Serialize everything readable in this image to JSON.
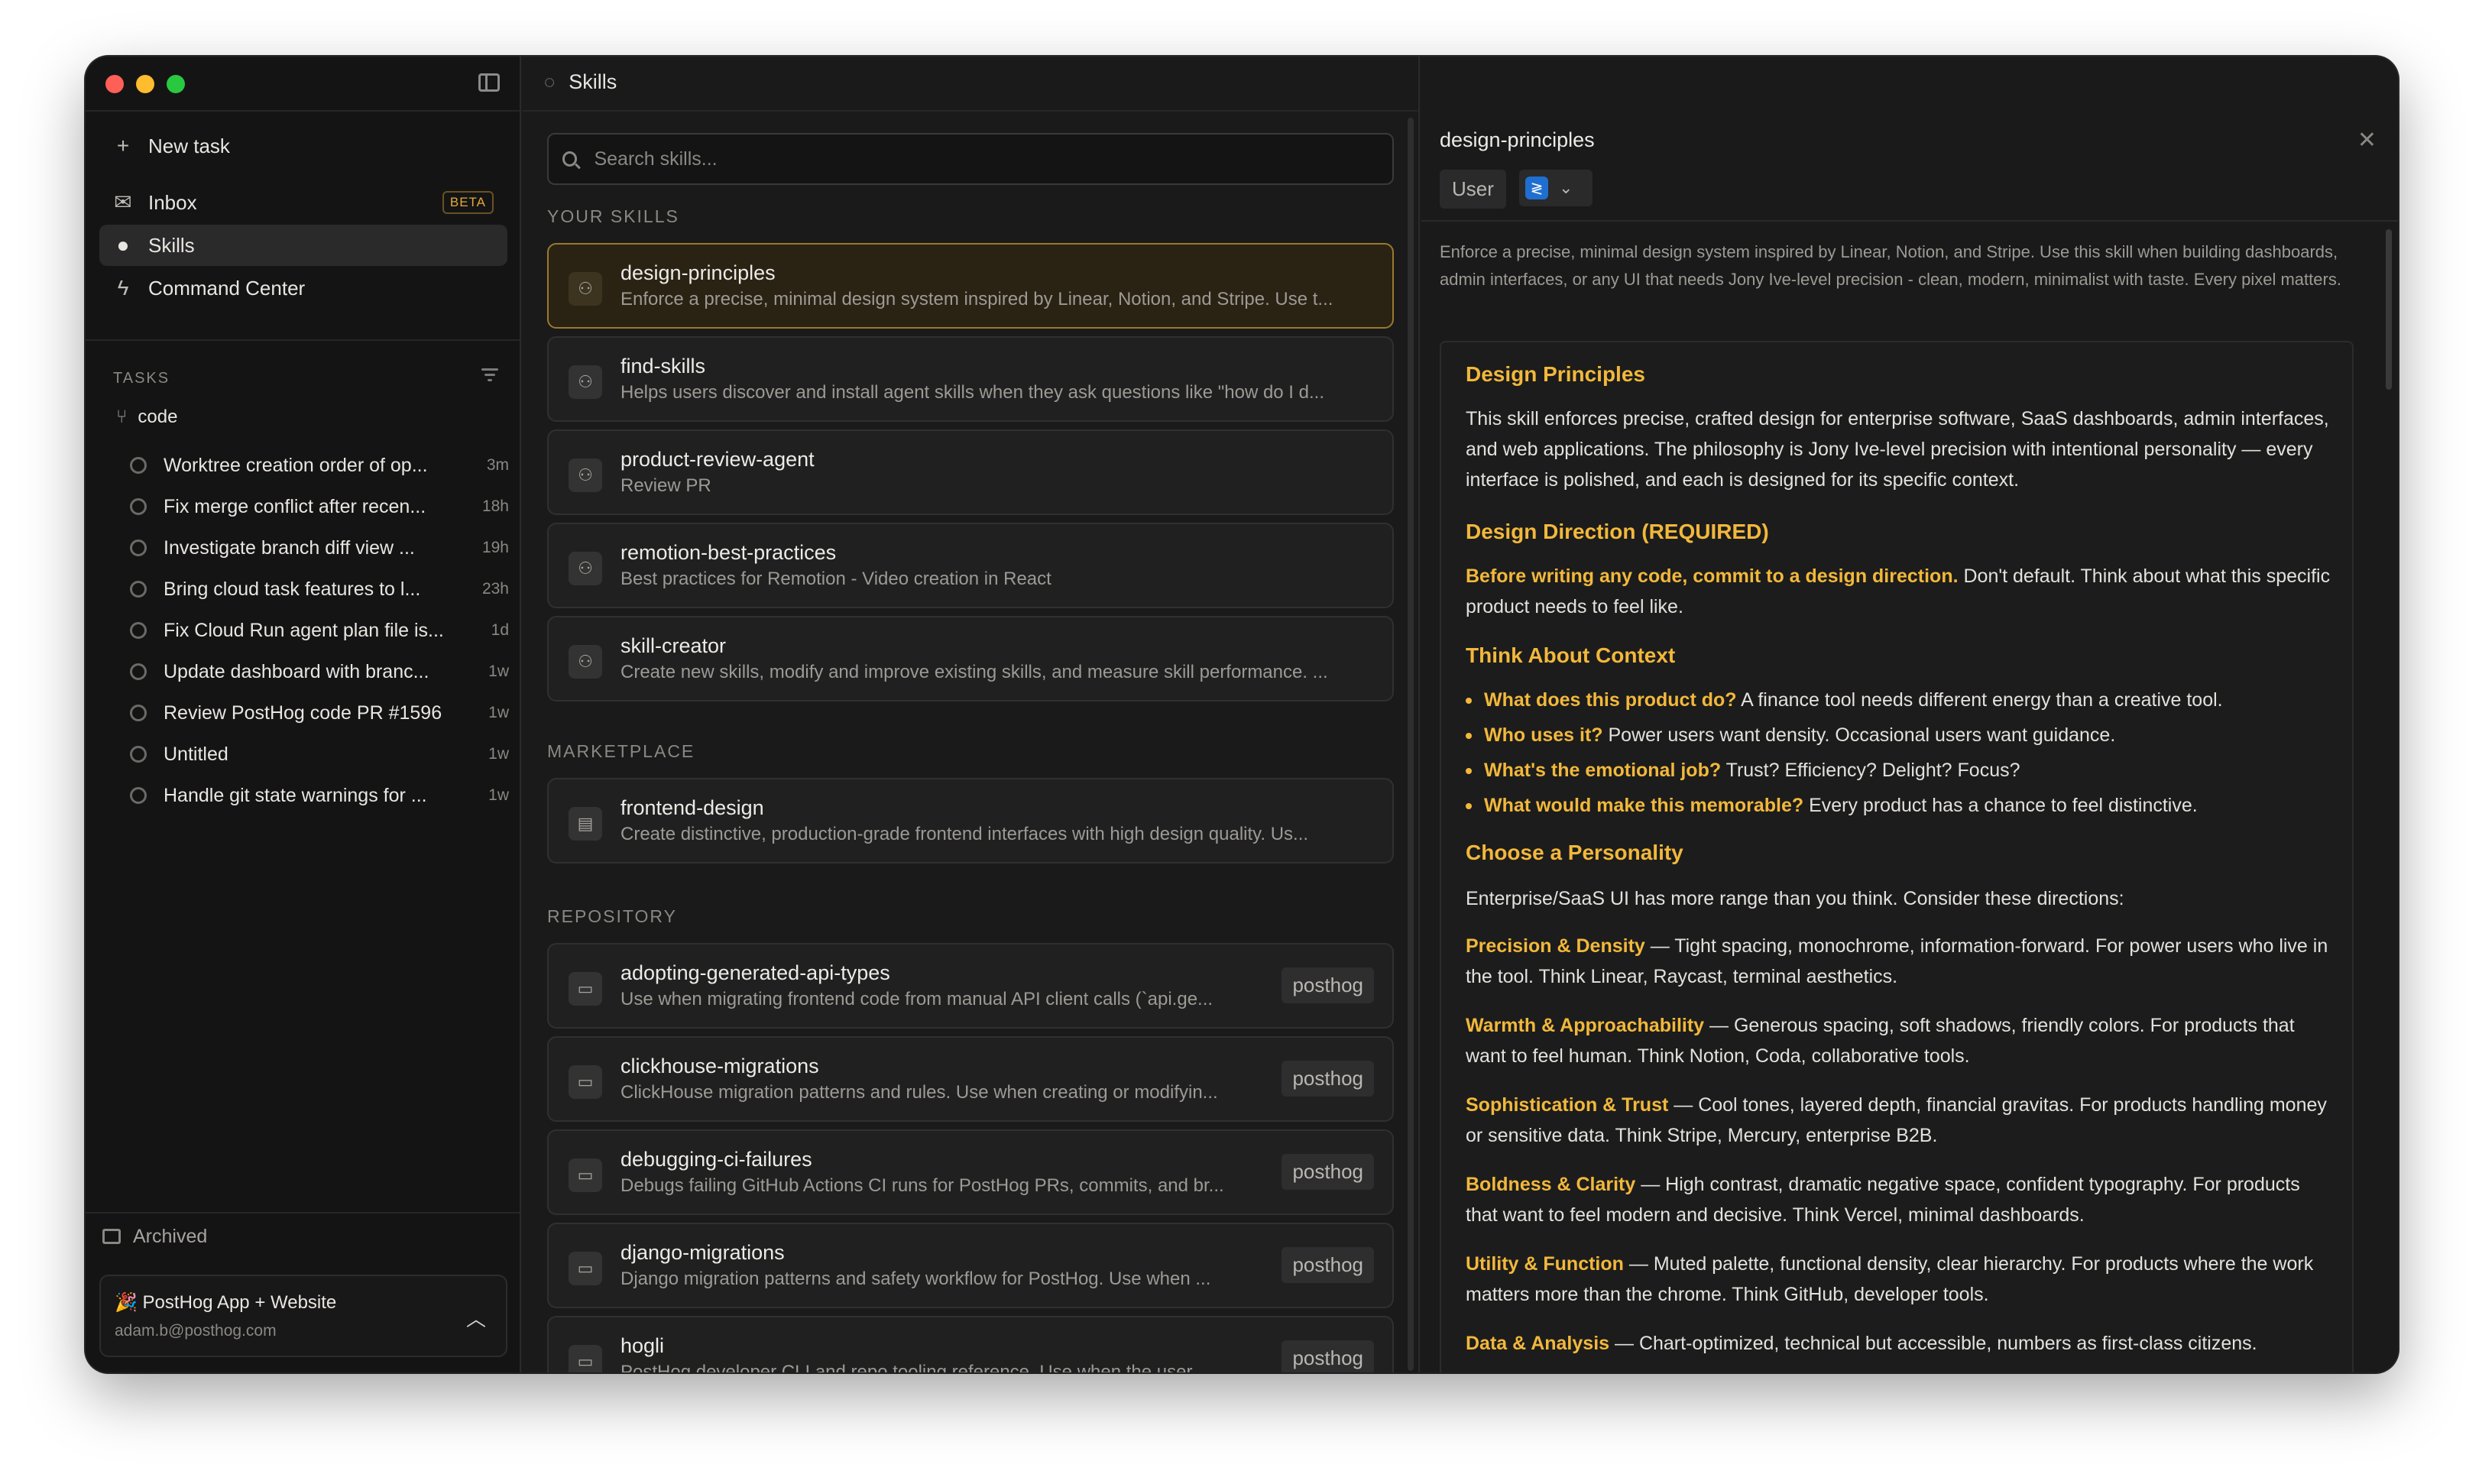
{
  "window": {
    "title": "Skills"
  },
  "sidebar": {
    "new_task": "New task",
    "nav": [
      {
        "label": "Inbox",
        "badge": "BETA"
      },
      {
        "label": "Skills"
      },
      {
        "label": "Command Center"
      }
    ],
    "tasks_label": "TASKS",
    "repo": "code",
    "tasks": [
      {
        "title": "Worktree creation order of op...",
        "age": "3m"
      },
      {
        "title": "Fix merge conflict after recen...",
        "age": "18h"
      },
      {
        "title": "Investigate branch diff view ...",
        "age": "19h"
      },
      {
        "title": "Bring cloud task features to l...",
        "age": "23h"
      },
      {
        "title": "Fix Cloud Run agent plan file is...",
        "age": "1d"
      },
      {
        "title": "Update dashboard with branc...",
        "age": "1w"
      },
      {
        "title": "Review PostHog code PR #1596",
        "age": "1w"
      },
      {
        "title": "Untitled",
        "age": "1w"
      },
      {
        "title": "Handle git state warnings for ...",
        "age": "1w"
      }
    ],
    "archived": "Archived",
    "workspace": {
      "name": "🎉 PostHog App + Website",
      "email": "adam.b@posthog.com"
    }
  },
  "search": {
    "placeholder": "Search skills..."
  },
  "groups": {
    "your_skills": "YOUR SKILLS",
    "marketplace": "MARKETPLACE",
    "repository": "REPOSITORY"
  },
  "your_skills": [
    {
      "name": "design-principles",
      "desc": "Enforce a precise, minimal design system inspired by Linear, Notion, and Stripe. Use t..."
    },
    {
      "name": "find-skills",
      "desc": "Helps users discover and install agent skills when they ask questions like \"how do I d..."
    },
    {
      "name": "product-review-agent",
      "desc": "Review PR"
    },
    {
      "name": "remotion-best-practices",
      "desc": "Best practices for Remotion - Video creation in React"
    },
    {
      "name": "skill-creator",
      "desc": "Create new skills, modify and improve existing skills, and measure skill performance. ..."
    }
  ],
  "marketplace": [
    {
      "name": "frontend-design",
      "desc": "Create distinctive, production-grade frontend interfaces with high design quality. Us..."
    }
  ],
  "repository": [
    {
      "name": "adopting-generated-api-types",
      "desc": "Use when migrating frontend code from manual API client calls (`api.ge...",
      "tag": "posthog"
    },
    {
      "name": "clickhouse-migrations",
      "desc": "ClickHouse migration patterns and rules. Use when creating or modifyin...",
      "tag": "posthog"
    },
    {
      "name": "debugging-ci-failures",
      "desc": "Debugs failing GitHub Actions CI runs for PostHog PRs, commits, and br...",
      "tag": "posthog"
    },
    {
      "name": "django-migrations",
      "desc": "Django migration patterns and safety workflow for PostHog. Use when ...",
      "tag": "posthog"
    },
    {
      "name": "hogli",
      "desc": "PostHog developer CLI and repo tooling reference. Use when the user...",
      "tag": "posthog"
    }
  ],
  "detail": {
    "title": "design-principles",
    "scope": "User",
    "description": "Enforce a precise, minimal design system inspired by Linear, Notion, and Stripe. Use this skill when building dashboards, admin interfaces, or any UI that needs Jony Ive-level precision - clean, modern, minimalist with taste. Every pixel matters.",
    "h1": "Design Principles",
    "p1": "This skill enforces precise, crafted design for enterprise software, SaaS dashboards, admin interfaces, and web applications. The philosophy is Jony Ive-level precision with intentional personality — every interface is polished, and each is designed for its specific context.",
    "h2": "Design Direction (REQUIRED)",
    "p2_bold": "Before writing any code, commit to a design direction.",
    "p2_rest": " Don't default. Think about what this specific product needs to feel like.",
    "h3": "Think About Context",
    "bullets": [
      {
        "bold": "What does this product do?",
        "rest": " A finance tool needs different energy than a creative tool."
      },
      {
        "bold": "Who uses it?",
        "rest": " Power users want density. Occasional users want guidance."
      },
      {
        "bold": "What's the emotional job?",
        "rest": " Trust? Efficiency? Delight? Focus?"
      },
      {
        "bold": "What would make this memorable?",
        "rest": " Every product has a chance to feel distinctive."
      }
    ],
    "h4": "Choose a Personality",
    "p4": "Enterprise/SaaS UI has more range than you think. Consider these directions:",
    "personalities": [
      {
        "bold": "Precision & Density",
        "rest": " — Tight spacing, monochrome, information-forward. For power users who live in the tool. Think Linear, Raycast, terminal aesthetics."
      },
      {
        "bold": "Warmth & Approachability",
        "rest": " — Generous spacing, soft shadows, friendly colors. For products that want to feel human. Think Notion, Coda, collaborative tools."
      },
      {
        "bold": "Sophistication & Trust",
        "rest": " — Cool tones, layered depth, financial gravitas. For products handling money or sensitive data. Think Stripe, Mercury, enterprise B2B."
      },
      {
        "bold": "Boldness & Clarity",
        "rest": " — High contrast, dramatic negative space, confident typography. For products that want to feel modern and decisive. Think Vercel, minimal dashboards."
      },
      {
        "bold": "Utility & Function",
        "rest": " — Muted palette, functional density, clear hierarchy. For products where the work matters more than the chrome. Think GitHub, developer tools."
      },
      {
        "bold": "Data & Analysis",
        "rest": " — Chart-optimized, technical but accessible, numbers as first-class citizens."
      }
    ]
  },
  "colors": {
    "accent": "#f2b83b",
    "bg": "#1b1b1b",
    "traffic": [
      "#fe5f57",
      "#febc2e",
      "#28c840"
    ]
  },
  "icons": {
    "skills": "lightbulb-icon",
    "inbox": "envelope-icon",
    "command": "bolt-icon",
    "repo": "branch-icon",
    "user_skill": "person-icon",
    "marketplace_skill": "store-icon",
    "repo_skill": "folder-icon",
    "app": "vscode-icon"
  }
}
